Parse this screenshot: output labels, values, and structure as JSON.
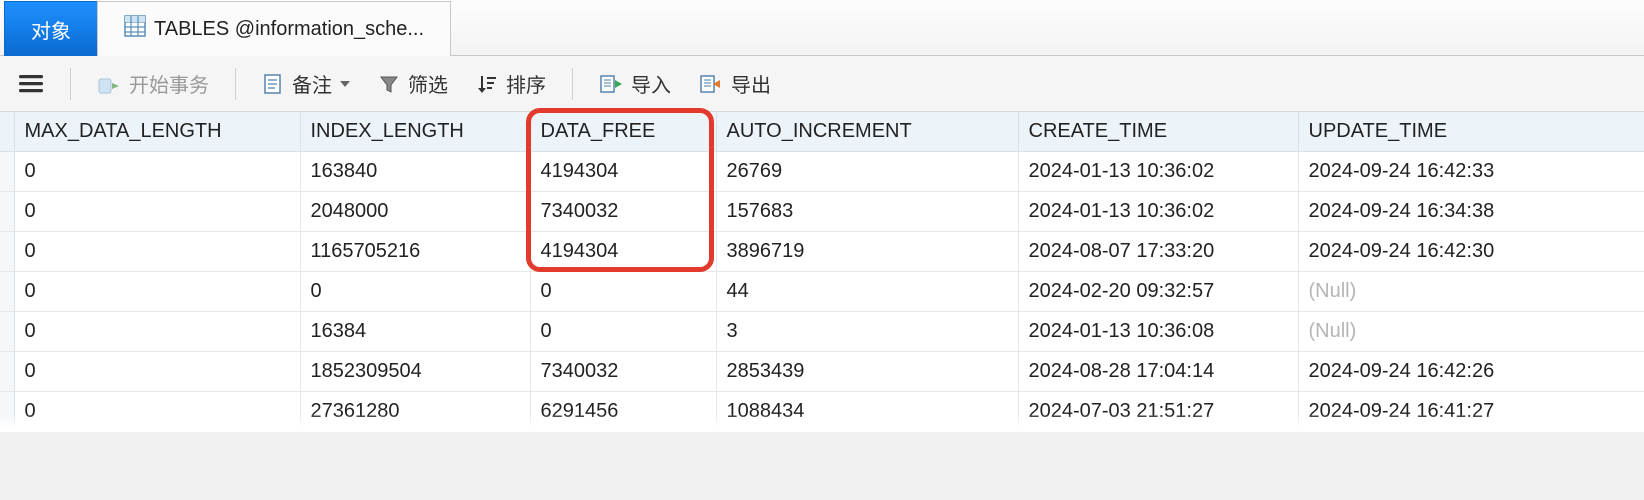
{
  "tabs": {
    "objects_label": "对象",
    "tables_label": "TABLES @information_sche..."
  },
  "toolbar": {
    "begin_tx": "开始事务",
    "memo": "备注",
    "filter": "筛选",
    "sort": "排序",
    "import": "导入",
    "export": "导出"
  },
  "columns": {
    "max_data_length": "MAX_DATA_LENGTH",
    "index_length": "INDEX_LENGTH",
    "data_free": "DATA_FREE",
    "auto_increment": "AUTO_INCREMENT",
    "create_time": "CREATE_TIME",
    "update_time": "UPDATE_TIME"
  },
  "null_text": "(Null)",
  "rows": [
    {
      "max_data_length": "0",
      "index_length": "163840",
      "data_free": "4194304",
      "auto_increment": "26769",
      "create_time": "2024-01-13 10:36:02",
      "update_time": "2024-09-24 16:42:33"
    },
    {
      "max_data_length": "0",
      "index_length": "2048000",
      "data_free": "7340032",
      "auto_increment": "157683",
      "create_time": "2024-01-13 10:36:02",
      "update_time": "2024-09-24 16:34:38"
    },
    {
      "max_data_length": "0",
      "index_length": "1165705216",
      "data_free": "4194304",
      "auto_increment": "3896719",
      "create_time": "2024-08-07 17:33:20",
      "update_time": "2024-09-24 16:42:30"
    },
    {
      "max_data_length": "0",
      "index_length": "0",
      "data_free": "0",
      "auto_increment": "44",
      "create_time": "2024-02-20 09:32:57",
      "update_time": null
    },
    {
      "max_data_length": "0",
      "index_length": "16384",
      "data_free": "0",
      "auto_increment": "3",
      "create_time": "2024-01-13 10:36:08",
      "update_time": null
    },
    {
      "max_data_length": "0",
      "index_length": "1852309504",
      "data_free": "7340032",
      "auto_increment": "2853439",
      "create_time": "2024-08-28 17:04:14",
      "update_time": "2024-09-24 16:42:26"
    },
    {
      "max_data_length": "0",
      "index_length": "27361280",
      "data_free": "6291456",
      "auto_increment": "1088434",
      "create_time": "2024-07-03 21:51:27",
      "update_time": "2024-09-24 16:41:27"
    }
  ]
}
